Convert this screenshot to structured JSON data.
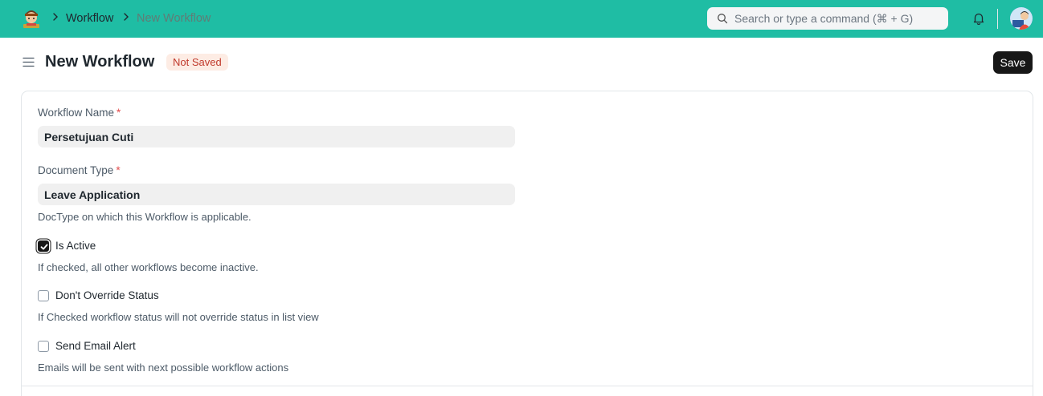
{
  "navbar": {
    "breadcrumbs": [
      {
        "label": "Workflow"
      },
      {
        "label": "New Workflow"
      }
    ],
    "search": {
      "placeholder": "Search or type a command (⌘ + G)",
      "value": ""
    },
    "icons": [
      "app-logo-icon",
      "chevron-right-icon",
      "search-icon",
      "bell-icon",
      "avatar"
    ],
    "accent_color": "#1fbda4"
  },
  "page": {
    "title": "New Workflow",
    "status_badge": "Not Saved",
    "save_label": "Save"
  },
  "form": {
    "workflow_name": {
      "label": "Workflow Name",
      "required_mark": "*",
      "value": "Persetujuan Cuti"
    },
    "document_type": {
      "label": "Document Type",
      "required_mark": "*",
      "value": "Leave Application",
      "description": "DocType on which this Workflow is applicable."
    },
    "is_active": {
      "label": "Is Active",
      "checked": true,
      "description": "If checked, all other workflows become inactive."
    },
    "dont_override_status": {
      "label": "Don't Override Status",
      "checked": false,
      "description": "If Checked workflow status will not override status in list view"
    },
    "send_email_alert": {
      "label": "Send Email Alert",
      "checked": false,
      "description": "Emails will be sent with next possible workflow actions"
    }
  }
}
